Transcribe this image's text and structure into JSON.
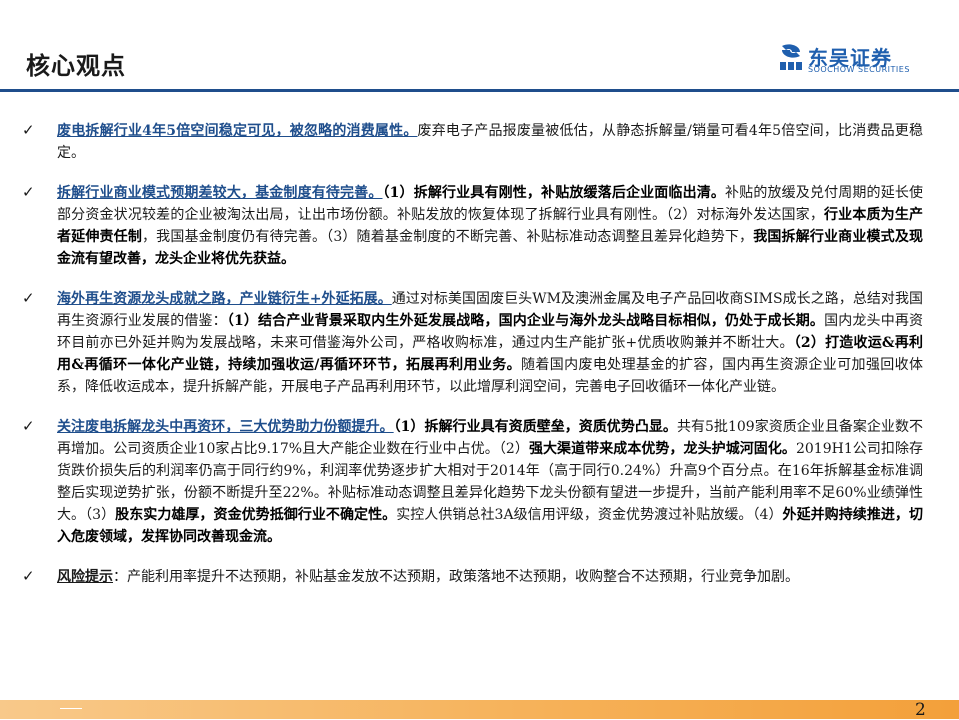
{
  "header": {
    "title": "核心观点",
    "logo_cn": "东吴证券",
    "logo_en": "SOOCHOW SECURITIES",
    "brand_color": "#1f5fae",
    "rule_color": "#1f4e8c"
  },
  "bullets": [
    {
      "lead": "废电拆解行业4年5倍空间稳定可见，被忽略的消费属性。",
      "parts": [
        {
          "text": "废弃电子产品报废量被低估，从静态拆解量/销量可看4年5倍空间，比消费品更稳定。",
          "bold": false
        }
      ]
    },
    {
      "lead": "拆解行业商业模式预期差较大，基金制度有待完善。",
      "parts": [
        {
          "text": "（1）拆解行业具有刚性，补贴放缓落后企业面临出清。",
          "bold": true
        },
        {
          "text": "补贴的放缓及兑付周期的延长使部分资金状况较差的企业被淘汰出局，让出市场份额。补贴发放的恢复体现了拆解行业具有刚性。（2）对标海外发达国家，",
          "bold": false
        },
        {
          "text": "行业本质为生产者延伸责任制",
          "bold": true
        },
        {
          "text": "，我国基金制度仍有待完善。（3）随着基金制度的不断完善、补贴标准动态调整且差异化趋势下，",
          "bold": false
        },
        {
          "text": "我国拆解行业商业模式及现金流有望改善，龙头企业将优先获益",
          "bold": true
        },
        {
          "text": "。",
          "bold": false
        }
      ]
    },
    {
      "lead": "海外再生资源龙头成就之路，产业链衍生+外延拓展。",
      "parts": [
        {
          "text": "通过对标美国固废巨头WM及澳洲金属及电子产品回收商SIMS成长之路，总结对我国再生资源行业发展的借鉴：",
          "bold": false
        },
        {
          "text": "（1）结合产业背景采取内生外延发展战略，国内企业与海外龙头战略目标相似，仍处于成长期。",
          "bold": true
        },
        {
          "text": "国内龙头中再资环目前亦已外延并购为发展战略，未来可借鉴海外公司，严格收购标准，通过内生产能扩张+优质收购兼并不断壮大。",
          "bold": false
        },
        {
          "text": "（2）打造收运&再利用&再循环一体化产业链，持续加强收运/再循环环节，拓展再利用业务。",
          "bold": true
        },
        {
          "text": "随着国内废电处理基金的扩容，国内再生资源企业可加强回收体系，降低收运成本，提升拆解产能，开展电子产品再利用环节，以此增厚利润空间，完善电子回收循环一体化产业链。",
          "bold": false
        }
      ]
    },
    {
      "lead": "关注废电拆解龙头中再资环，三大优势助力份额提升。",
      "parts": [
        {
          "text": "（1）拆解行业具有资质壁垒，资质优势凸显。",
          "bold": true
        },
        {
          "text": "共有5批109家资质企业且备案企业数不再增加。公司资质企业10家占比9.17%且大产能企业数在行业中占优。（2）",
          "bold": false
        },
        {
          "text": "强大渠道带来成本优势，龙头护城河固化。",
          "bold": true
        },
        {
          "text": "2019H1公司扣除存货跌价损失后的利润率仍高于同行约9%，利润率优势逐步扩大相对于2014年（高于同行0.24%）升高9个百分点。在16年拆解基金标准调整后实现逆势扩张，份额不断提升至22%。补贴标准动态调整且差异化趋势下龙头份额有望进一步提升，当前产能利用率不足60%业绩弹性大。（3）",
          "bold": false
        },
        {
          "text": "股东实力雄厚，资金优势抵御行业不确定性。",
          "bold": true
        },
        {
          "text": "实控人供销总社3A级信用评级，资金优势渡过补贴放缓。（4）",
          "bold": false
        },
        {
          "text": "外延并购持续推进，切入危废领域，发挥协同改善现金流。",
          "bold": true
        }
      ]
    },
    {
      "lead": "风险提示",
      "lead_style": "black",
      "parts": [
        {
          "text": "：产能利用率提升不达预期，补贴基金发放不达预期，政策落地不达预期，收购整合不达预期，行业竞争加剧。",
          "bold": false
        }
      ]
    }
  ],
  "footer": {
    "page_number": "2",
    "bar_color": "#f6b25a"
  }
}
